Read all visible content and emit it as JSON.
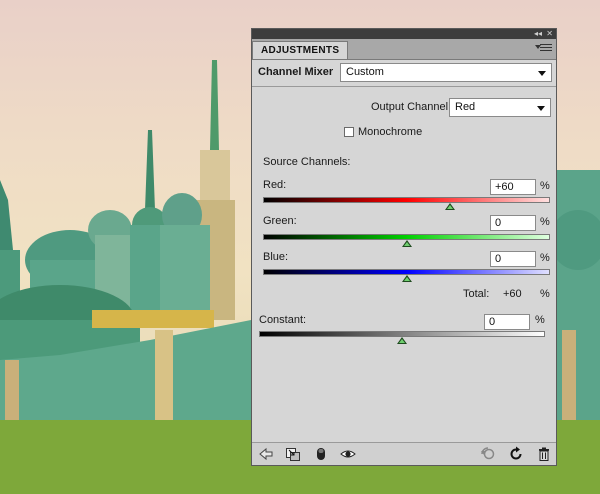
{
  "panel": {
    "tab_label": "ADJUSTMENTS",
    "title": "Channel Mixer",
    "preset_value": "Custom",
    "output_channel_label": "Output Channel:",
    "output_channel_value": "Red",
    "monochrome_label": "Monochrome",
    "monochrome_checked": false,
    "source_channels_label": "Source Channels:",
    "channels": [
      {
        "name": "Red:",
        "value": "+60",
        "unit": "%",
        "level": 0.65,
        "gradient": [
          "#000000",
          "#ff0000",
          "#ffe0e0"
        ]
      },
      {
        "name": "Green:",
        "value": "0",
        "unit": "%",
        "level": 0.5,
        "gradient": [
          "#000000",
          "#00d000",
          "#e0ffe0"
        ]
      },
      {
        "name": "Blue:",
        "value": "0",
        "unit": "%",
        "level": 0.5,
        "gradient": [
          "#000000",
          "#0000ff",
          "#e0e0ff"
        ]
      }
    ],
    "total_label": "Total:",
    "total_value": "+60",
    "total_unit": "%",
    "constant_label": "Constant:",
    "constant_value": "0",
    "constant_unit": "%",
    "constant_level": 0.5,
    "footer_icons": [
      "back-arrow-icon",
      "clip-to-layer-icon",
      "mask-icon",
      "visibility-eye-icon",
      "previous-state-icon",
      "reset-icon",
      "trash-icon"
    ]
  }
}
